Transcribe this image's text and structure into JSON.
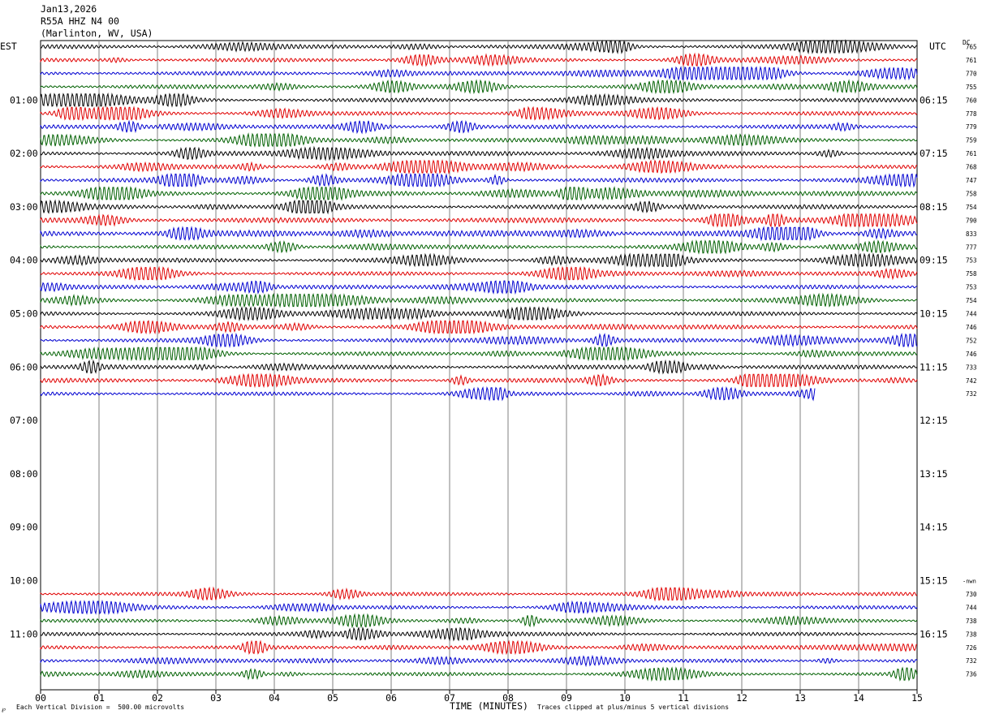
{
  "header": {
    "date": "Jan13,2026",
    "station": "R55A HHZ N4 00",
    "location": "(Marlinton, WV, USA)"
  },
  "timezones": {
    "left": "EST",
    "right": "UTC",
    "dc_label": "DC"
  },
  "footer": {
    "scale": "Each Vertical Division =  500.00 microvolts",
    "xlabel": "TIME (MINUTES)",
    "clip_note": "Traces clipped at plus/minus 5 vertical divisions",
    "icon_glyph": "℘"
  },
  "colors": {
    "black": "#000000",
    "red": "#e00000",
    "blue": "#0000d0",
    "green": "#006000",
    "grid": "#808080"
  },
  "chart_data": {
    "type": "line",
    "title": "Jan13,2026",
    "xlabel": "TIME (MINUTES)",
    "xlim": [
      0,
      15
    ],
    "x_ticks": [
      "00",
      "01",
      "02",
      "03",
      "04",
      "05",
      "06",
      "07",
      "08",
      "09",
      "10",
      "11",
      "12",
      "13",
      "14",
      "15"
    ],
    "left_hour_labels": [
      "01:00",
      "02:00",
      "03:00",
      "04:00",
      "05:00",
      "06:00",
      "07:00",
      "08:00",
      "09:00",
      "10:00",
      "11:00"
    ],
    "right_hour_labels": [
      "06:15",
      "07:15",
      "08:15",
      "09:15",
      "10:15",
      "11:15",
      "12:15",
      "13:15",
      "14:15",
      "15:15",
      "16:15"
    ],
    "gap_marker": "-nwn",
    "rows": [
      {
        "row": 0,
        "color": "black",
        "dc": "765",
        "amp": 1.0,
        "end": 15
      },
      {
        "row": 1,
        "color": "red",
        "dc": "761",
        "amp": 1.0,
        "end": 15
      },
      {
        "row": 2,
        "color": "blue",
        "dc": "770",
        "amp": 1.0,
        "end": 15
      },
      {
        "row": 3,
        "color": "green",
        "dc": "755",
        "amp": 1.0,
        "end": 15
      },
      {
        "row": 4,
        "color": "black",
        "dc": "760",
        "amp": 1.0,
        "end": 15
      },
      {
        "row": 5,
        "color": "red",
        "dc": "778",
        "amp": 1.0,
        "end": 15
      },
      {
        "row": 6,
        "color": "blue",
        "dc": "779",
        "amp": 1.0,
        "end": 15
      },
      {
        "row": 7,
        "color": "green",
        "dc": "759",
        "amp": 1.0,
        "end": 15
      },
      {
        "row": 8,
        "color": "black",
        "dc": "761",
        "amp": 1.1,
        "end": 15
      },
      {
        "row": 9,
        "color": "red",
        "dc": "768",
        "amp": 1.0,
        "end": 15
      },
      {
        "row": 10,
        "color": "blue",
        "dc": "747",
        "amp": 1.1,
        "end": 15
      },
      {
        "row": 11,
        "color": "green",
        "dc": "758",
        "amp": 1.2,
        "end": 15
      },
      {
        "row": 12,
        "color": "black",
        "dc": "754",
        "amp": 1.1,
        "end": 15
      },
      {
        "row": 13,
        "color": "red",
        "dc": "790",
        "amp": 1.3,
        "end": 15
      },
      {
        "row": 14,
        "color": "blue",
        "dc": "833",
        "amp": 1.5,
        "end": 15
      },
      {
        "row": 15,
        "color": "green",
        "dc": "777",
        "amp": 1.0,
        "end": 15
      },
      {
        "row": 16,
        "color": "black",
        "dc": "753",
        "amp": 1.1,
        "end": 15
      },
      {
        "row": 17,
        "color": "red",
        "dc": "758",
        "amp": 1.0,
        "end": 15
      },
      {
        "row": 18,
        "color": "blue",
        "dc": "753",
        "amp": 1.0,
        "end": 15
      },
      {
        "row": 19,
        "color": "green",
        "dc": "754",
        "amp": 1.0,
        "end": 15
      },
      {
        "row": 20,
        "color": "black",
        "dc": "744",
        "amp": 1.0,
        "end": 15
      },
      {
        "row": 21,
        "color": "red",
        "dc": "746",
        "amp": 1.1,
        "end": 15
      },
      {
        "row": 22,
        "color": "blue",
        "dc": "752",
        "amp": 1.0,
        "end": 15
      },
      {
        "row": 23,
        "color": "green",
        "dc": "746",
        "amp": 1.0,
        "end": 15
      },
      {
        "row": 24,
        "color": "black",
        "dc": "733",
        "amp": 1.1,
        "end": 15
      },
      {
        "row": 25,
        "color": "red",
        "dc": "742",
        "amp": 1.1,
        "end": 15
      },
      {
        "row": 26,
        "color": "blue",
        "dc": "732",
        "amp": 0.9,
        "end": 13.25
      },
      {
        "row": 41,
        "color": "red",
        "dc": "730",
        "amp": 0.9,
        "end": 15
      },
      {
        "row": 42,
        "color": "blue",
        "dc": "744",
        "amp": 0.9,
        "end": 15
      },
      {
        "row": 43,
        "color": "green",
        "dc": "738",
        "amp": 0.9,
        "end": 15
      },
      {
        "row": 44,
        "color": "black",
        "dc": "738",
        "amp": 0.9,
        "end": 15
      },
      {
        "row": 45,
        "color": "red",
        "dc": "726",
        "amp": 0.9,
        "end": 15
      },
      {
        "row": 46,
        "color": "blue",
        "dc": "732",
        "amp": 0.9,
        "end": 15
      },
      {
        "row": 47,
        "color": "green",
        "dc": "736",
        "amp": 0.9,
        "end": 15
      }
    ]
  }
}
